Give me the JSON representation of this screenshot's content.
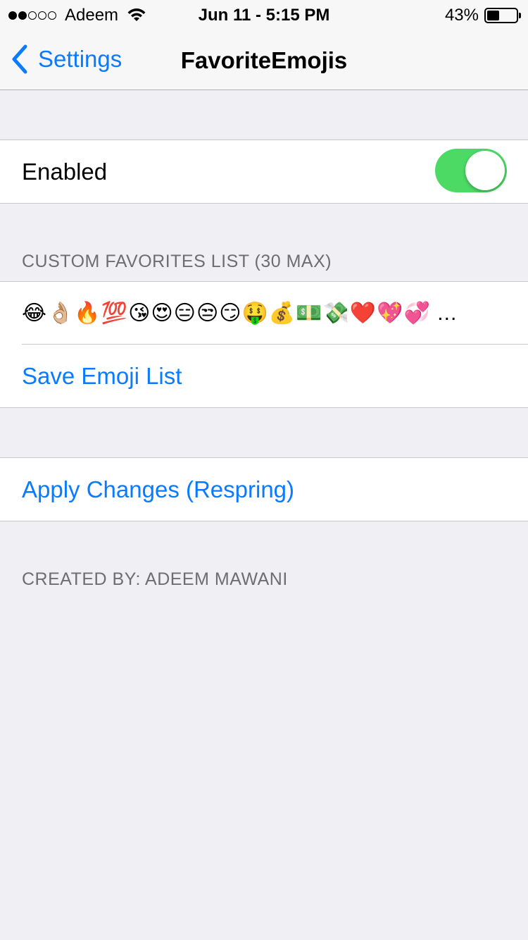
{
  "status_bar": {
    "carrier": "Adeem",
    "time": "Jun 11 - 5:15 PM",
    "battery_percent": "43%",
    "battery_level": 0.43,
    "signal_bars_filled": 2,
    "signal_bars_total": 5
  },
  "nav": {
    "back_label": "Settings",
    "title": "FavoriteEmojis"
  },
  "enabled_cell": {
    "label": "Enabled",
    "toggle_on": true
  },
  "favorites_section": {
    "header": "CUSTOM FAVORITES LIST (30 MAX)",
    "emoji_list": "😂👌🏼🔥💯😘😍😑😒😏🤑💰💵💸❤️💖💞 ...",
    "save_label": "Save Emoji List"
  },
  "apply_cell": {
    "label": "Apply Changes (Respring)"
  },
  "footer": {
    "text": "CREATED BY: ADEEM MAWANI"
  },
  "colors": {
    "accent": "#0a7aff",
    "toggle_on": "#4cd964",
    "background": "#efeff4",
    "section_text": "#6d6d72"
  }
}
